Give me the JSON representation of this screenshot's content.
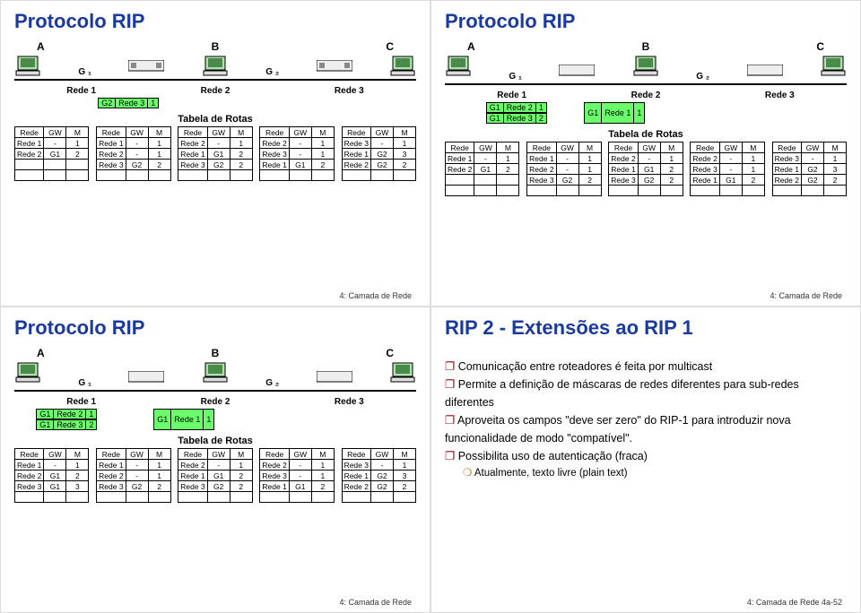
{
  "common": {
    "title_rip": "Protocolo RIP",
    "title_rip2": "RIP 2 - Extensões ao RIP 1",
    "tabela": "Tabela de Rotas",
    "footer": "4: Camada de Rede",
    "footer2": "4: Camada de Rede  4a-52",
    "A": "A",
    "B": "B",
    "C": "C",
    "G1": "G ₁",
    "G2": "G ₂",
    "Rede1": "Rede 1",
    "Rede2": "Rede 2",
    "Rede3": "Rede 3"
  },
  "hdr": {
    "c1": "Rede",
    "c2": "GW",
    "c3": "M"
  },
  "slide1": {
    "msgs": [
      [
        "G2",
        "Rede 3",
        "1"
      ]
    ],
    "tables": [
      [
        [
          "Rede 1",
          "-",
          "1"
        ],
        [
          "Rede 2",
          "G1",
          "2"
        ]
      ],
      [
        [
          "Rede 1",
          "-",
          "1"
        ],
        [
          "Rede 2",
          "-",
          "1"
        ],
        [
          "Rede 3",
          "G2",
          "2"
        ]
      ],
      [
        [
          "Rede 2",
          "-",
          "1"
        ],
        [
          "Rede 1",
          "G1",
          "2"
        ],
        [
          "Rede 3",
          "G2",
          "2"
        ]
      ],
      [
        [
          "Rede 2",
          "-",
          "1"
        ],
        [
          "Rede 3",
          "-",
          "1"
        ],
        [
          "Rede 1",
          "G1",
          "2"
        ]
      ],
      [
        [
          "Rede 3",
          "-",
          "1"
        ],
        [
          "Rede 1",
          "G2",
          "3"
        ],
        [
          "Rede 2",
          "G2",
          "2"
        ]
      ]
    ]
  },
  "slide2": {
    "msgs": [
      [
        "G1",
        "Rede 2",
        "1"
      ],
      [
        "G1",
        "Rede 3",
        "2"
      ],
      [
        "G1",
        "Rede 1",
        "1"
      ]
    ],
    "tables": [
      [
        [
          "Rede 1",
          "-",
          "1"
        ],
        [
          "Rede 2",
          "G1",
          "2"
        ]
      ],
      [
        [
          "Rede 1",
          "-",
          "1"
        ],
        [
          "Rede 2",
          "-",
          "1"
        ],
        [
          "Rede 3",
          "G2",
          "2"
        ]
      ],
      [
        [
          "Rede 2",
          "-",
          "1"
        ],
        [
          "Rede 1",
          "G1",
          "2"
        ],
        [
          "Rede 3",
          "G2",
          "2"
        ]
      ],
      [
        [
          "Rede 2",
          "-",
          "1"
        ],
        [
          "Rede 3",
          "-",
          "1"
        ],
        [
          "Rede 1",
          "G1",
          "2"
        ]
      ],
      [
        [
          "Rede 3",
          "-",
          "1"
        ],
        [
          "Rede 1",
          "G2",
          "3"
        ],
        [
          "Rede 2",
          "G2",
          "2"
        ]
      ]
    ]
  },
  "slide3": {
    "msgs": [
      [
        "G1",
        "Rede 2",
        "1"
      ],
      [
        "G1",
        "Rede 3",
        "2"
      ],
      [
        "G1",
        "Rede 1",
        "1"
      ]
    ],
    "tables": [
      [
        [
          "Rede 1",
          "-",
          "1"
        ],
        [
          "Rede 2",
          "G1",
          "2"
        ],
        [
          "Rede 3",
          "G1",
          "3"
        ]
      ],
      [
        [
          "Rede 1",
          "-",
          "1"
        ],
        [
          "Rede 2",
          "-",
          "1"
        ],
        [
          "Rede 3",
          "G2",
          "2"
        ]
      ],
      [
        [
          "Rede 2",
          "-",
          "1"
        ],
        [
          "Rede 1",
          "G1",
          "2"
        ],
        [
          "Rede 3",
          "G2",
          "2"
        ]
      ],
      [
        [
          "Rede 2",
          "-",
          "1"
        ],
        [
          "Rede 3",
          "-",
          "1"
        ],
        [
          "Rede 1",
          "G1",
          "2"
        ]
      ],
      [
        [
          "Rede 3",
          "-",
          "1"
        ],
        [
          "Rede 1",
          "G2",
          "3"
        ],
        [
          "Rede 2",
          "G2",
          "2"
        ]
      ]
    ]
  },
  "slide4": {
    "bullets": [
      {
        "t": "Comunicação entre roteadores é feita por multicast",
        "l": 1
      },
      {
        "t": "Permite a definição de máscaras de redes diferentes para sub-redes diferentes",
        "l": 1
      },
      {
        "t": "Aproveita os campos \"deve ser zero\" do RIP-1 para introduzir nova funcionalidade de modo \"compatível\".",
        "l": 1
      },
      {
        "t": "Possibilita uso de autenticação (fraca)",
        "l": 1
      },
      {
        "t": "Atualmente, texto livre (plain text)",
        "l": 2
      }
    ]
  }
}
